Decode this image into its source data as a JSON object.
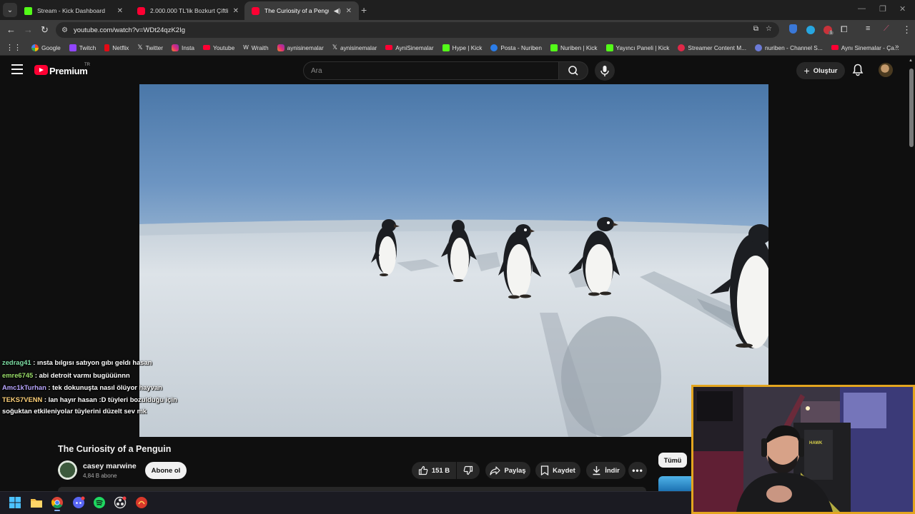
{
  "browser": {
    "tabs": [
      {
        "title": "Stream - Kick Dashboard",
        "active": false
      },
      {
        "title": "2.000.000 TL'lik Bozkurt Çiftliği",
        "active": false
      },
      {
        "title": "The Curiosity of a Penguin",
        "active": true
      }
    ],
    "url": "youtube.com/watch?v=WDt24qzK2Ig",
    "bookmarks": [
      "Google",
      "Twitch",
      "Netflix",
      "Twitter",
      "Insta",
      "Youtube",
      "Wraith",
      "aynisinemalar",
      "aynisinemalar",
      "AyniSinemalar",
      "Hype | Kick",
      "Posta - Nuriben",
      "Nuriben | Kick",
      "Yayıncı Paneli | Kick",
      "Streamer Content M...",
      "nuriben - Channel S...",
      "Aynı Sinemalar - Ça..."
    ],
    "extension_badge": "1"
  },
  "youtube": {
    "brand": "Premium",
    "region": "TR",
    "search_placeholder": "Ara",
    "create_label": "Oluştur"
  },
  "video": {
    "title": "The Curiosity of a Penguin",
    "channel_name": "casey marwine",
    "subscribers": "4,84 B abone",
    "subscribe_label": "Abone ol",
    "likes": "151 B",
    "share_label": "Paylaş",
    "save_label": "Kaydet",
    "download_label": "İndir",
    "filter_chip": "Tümü"
  },
  "chat": [
    {
      "user": "zedrag41",
      "color": "#7fe0a6",
      "message": "ınsta bılgısı satıyon gıbı geldı hasan"
    },
    {
      "user": "emre6745",
      "color": "#9bdf6a",
      "message": "abi detroit varmı bugüüünnn"
    },
    {
      "user": "Amc1kTurhan",
      "color": "#b9a6ff",
      "message": "tek dokunuşta nasıl ölüyor hayvan"
    },
    {
      "user": "TEKS7VENN",
      "color": "#ffd27a",
      "message": "lan hayır hasan :D tüyleri bozulduğu için soğuktan etkileniyolar tüylerini düzelt sev mk"
    }
  ],
  "colors": {
    "accent": "#ff0033",
    "webcam_border": "#e3a51f",
    "kick_green": "#53fc18"
  }
}
